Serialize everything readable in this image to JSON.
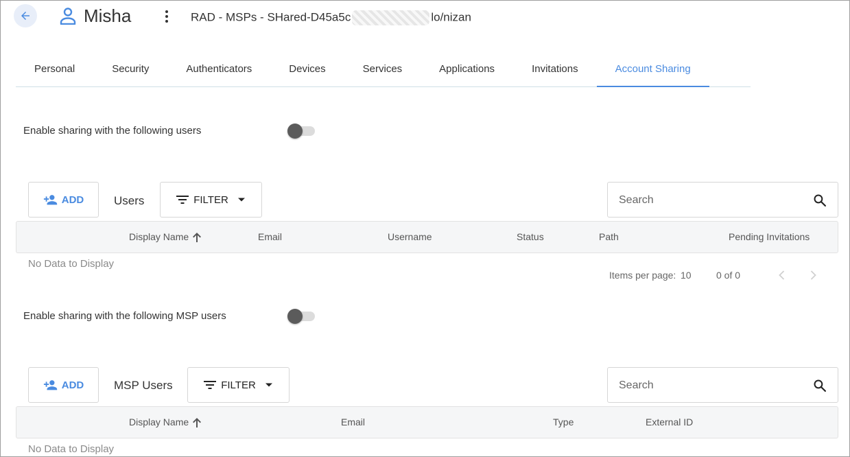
{
  "header": {
    "back_icon": "arrow-left-icon",
    "user_icon": "person-icon",
    "user_name": "Misha",
    "more_icon": "kebab-menu-icon",
    "path_prefix": "RAD - MSPs - SHared-D45a5c",
    "path_suffix": "lo/nizan",
    "accent_color": "#4a8be0"
  },
  "tabs": [
    {
      "label": "Personal"
    },
    {
      "label": "Security"
    },
    {
      "label": "Authenticators"
    },
    {
      "label": "Devices"
    },
    {
      "label": "Services"
    },
    {
      "label": "Applications"
    },
    {
      "label": "Invitations"
    },
    {
      "label": "Account Sharing",
      "active": true
    }
  ],
  "users_section": {
    "toggle_label": "Enable sharing with the following users",
    "toggle_on": false,
    "add_label": "ADD",
    "grid_label": "Users",
    "filter_label": "FILTER",
    "search_placeholder": "Search",
    "columns": [
      "Display Name",
      "Email",
      "Username",
      "Status",
      "Path",
      "Pending Invitations"
    ],
    "sort_column": "Display Name",
    "sort_direction": "ascending",
    "empty_text": "No Data to Display",
    "items_per_page_label": "Items per page:",
    "items_per_page": "10",
    "range_text": "0 of 0"
  },
  "msp_section": {
    "toggle_label": "Enable sharing with the following MSP users",
    "toggle_on": false,
    "add_label": "ADD",
    "grid_label": "MSP Users",
    "filter_label": "FILTER",
    "search_placeholder": "Search",
    "columns": [
      "Display Name",
      "Email",
      "Type",
      "External ID"
    ],
    "sort_column": "Display Name",
    "sort_direction": "ascending",
    "empty_text": "No Data to Display"
  }
}
